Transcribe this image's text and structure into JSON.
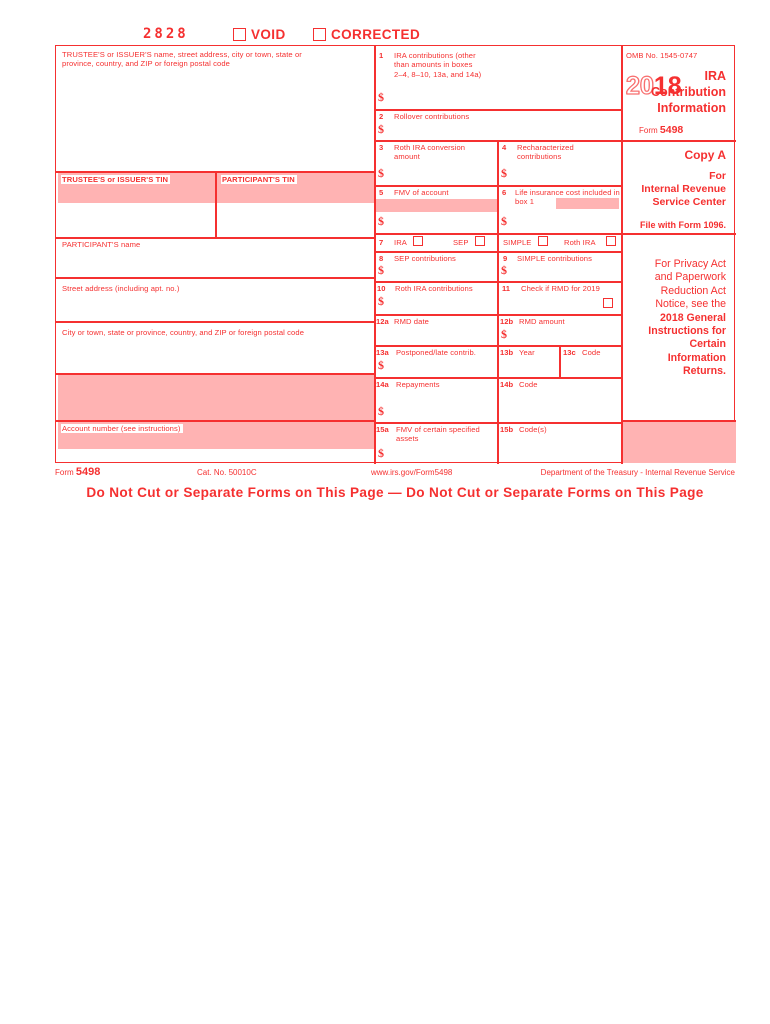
{
  "form": {
    "scan_code": "2828",
    "void_label": "VOID",
    "corrected_label": "CORRECTED",
    "form_number": "5498",
    "form_label_prefix": "Form",
    "cat_no": "Cat. No. 50010C",
    "url": "www.irs.gov/Form5498",
    "department": "Department of the Treasury - Internal Revenue Service",
    "do_not_cut": "Do Not Cut or Separate Forms on This Page — Do Not Cut or Separate Forms on This Page"
  },
  "header": {
    "omb": "OMB No. 1545-0747",
    "year_light": "20",
    "year_bold": "18",
    "form_caption_prefix": "Form",
    "form_caption_number": "5498",
    "title": "IRA\nContribution\nInformation",
    "copy": "Copy A",
    "for_irs": "For\nInternal Revenue\nService Center",
    "file_with": "File with Form 1096.",
    "privacy_line1": "For Privacy Act",
    "privacy_line2": "and Paperwork",
    "privacy_line3": "Reduction Act",
    "privacy_line4": "Notice, see the",
    "privacy_bold1": "2018 General",
    "privacy_bold2": "Instructions for",
    "privacy_bold3": "Certain",
    "privacy_bold4": "Information",
    "privacy_bold5": "Returns."
  },
  "payer": {
    "name_address": "TRUSTEE'S or ISSUER'S name, street address, city or town, state or\nprovince, country, and ZIP or foreign postal code",
    "trustee_tin": "TRUSTEE'S or ISSUER'S TIN",
    "participant_tin": "PARTICIPANT'S TIN",
    "participant_name": "PARTICIPANT'S name",
    "street_address": "Street address (including apt. no.)",
    "city_state_zip": "City or town, state or province, country, and ZIP or foreign postal code",
    "account_number": "Account number (see instructions)"
  },
  "boxes": {
    "b1": {
      "num": "1",
      "label": "IRA contributions (other\nthan amounts in boxes\n2–4, 8–10, 13a, and 14a)",
      "amount": ""
    },
    "b2": {
      "num": "2",
      "label": "Rollover contributions",
      "amount": ""
    },
    "b3": {
      "num": "3",
      "label": "Roth IRA conversion\namount",
      "amount": ""
    },
    "b4": {
      "num": "4",
      "label": "Recharacterized\ncontributions",
      "amount": ""
    },
    "b5": {
      "num": "5",
      "label": "FMV of account",
      "amount": ""
    },
    "b6": {
      "num": "6",
      "label": "Life insurance cost included in\nbox 1",
      "amount": ""
    },
    "b7": {
      "num": "7",
      "options": [
        {
          "label": "IRA",
          "checked": false
        },
        {
          "label": "SEP",
          "checked": false
        },
        {
          "label": "SIMPLE",
          "checked": false
        },
        {
          "label": "Roth IRA",
          "checked": false
        }
      ]
    },
    "b8": {
      "num": "8",
      "label": "SEP contributions",
      "amount": ""
    },
    "b9": {
      "num": "9",
      "label": "SIMPLE contributions",
      "amount": ""
    },
    "b10": {
      "num": "10",
      "label": "Roth IRA contributions",
      "amount": ""
    },
    "b11": {
      "num": "11",
      "label": "Check if RMD for 2019",
      "checked": false
    },
    "b12a": {
      "num": "12a",
      "label": "RMD date",
      "value": ""
    },
    "b12b": {
      "num": "12b",
      "label": "RMD amount",
      "amount": ""
    },
    "b13a": {
      "num": "13a",
      "label": "Postponed/late contrib.",
      "amount": ""
    },
    "b13b": {
      "num": "13b",
      "label": "Year",
      "value": ""
    },
    "b13c": {
      "num": "13c",
      "label": "Code",
      "value": ""
    },
    "b14a": {
      "num": "14a",
      "label": "Repayments",
      "amount": ""
    },
    "b14b": {
      "num": "14b",
      "label": "Code",
      "value": ""
    },
    "b15a": {
      "num": "15a",
      "label": "FMV of certain specified\nassets",
      "amount": ""
    },
    "b15b": {
      "num": "15b",
      "label": "Code(s)",
      "value": ""
    }
  },
  "colors": {
    "red": "#f53030",
    "pink": "#ffb3b3",
    "white": "#ffffff"
  }
}
